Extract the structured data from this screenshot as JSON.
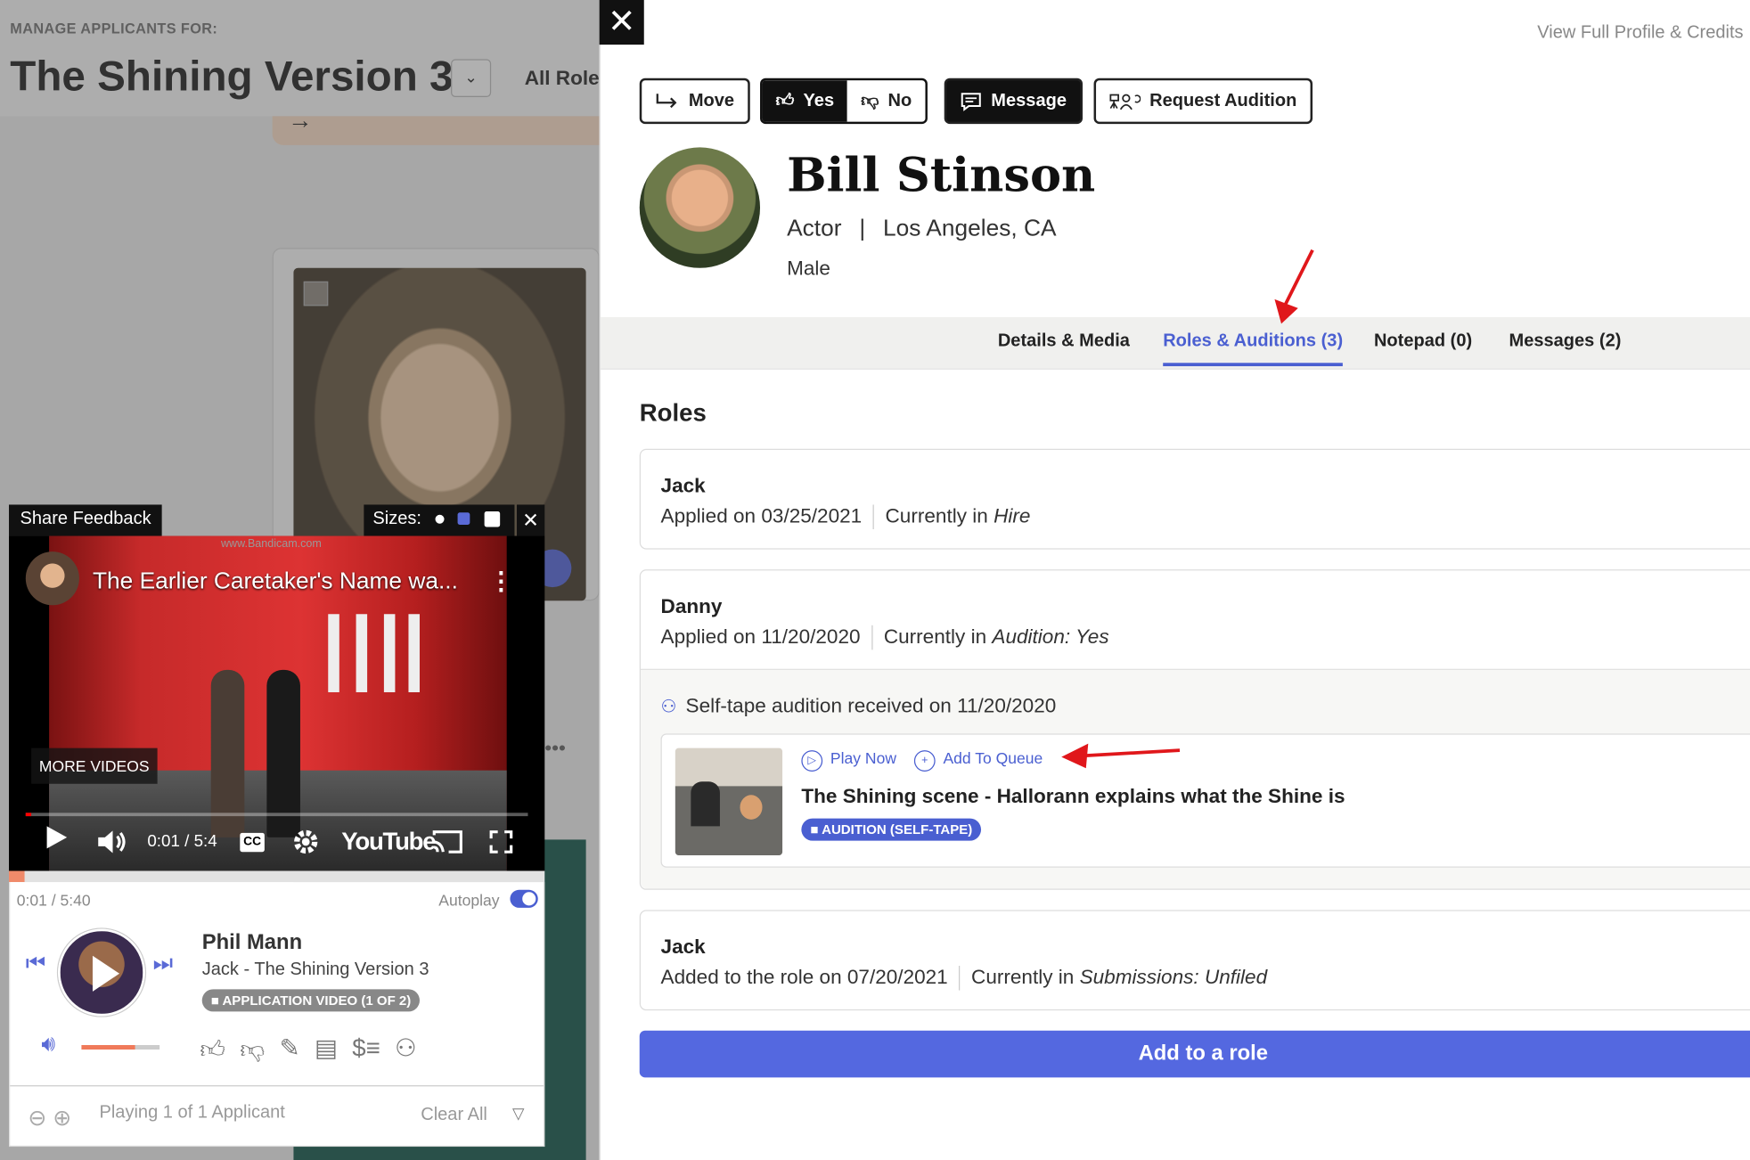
{
  "background": {
    "kicker": "MANAGE APPLICANTS FOR:",
    "project_title": "The Shining Version 3",
    "roles_filter": "All Role"
  },
  "player": {
    "share_feedback": "Share Feedback",
    "sizes_label": "Sizes:",
    "video_title": "The Earlier Caretaker's Name wa...",
    "watermark": "www.Bandicam.com",
    "more_videos": "MORE VIDEOS",
    "video_time": "0:01 / 5:4",
    "youtube": "YouTube",
    "cc": "CC",
    "elapsed": "0:01 / 5:40",
    "autoplay": "Autoplay",
    "applicant_name": "Phil Mann",
    "applicant_role": "Jack - The Shining Version 3",
    "badge": "APPLICATION VIDEO (1 OF 2)",
    "playing": "Playing 1 of 1 Applicant",
    "clear_all": "Clear All",
    "volume_level": 0.68,
    "video_progress": 0.003,
    "accent": "#4a5fd1"
  },
  "drawer": {
    "full_profile": "View Full Profile & Credits",
    "toolbar": {
      "move": "Move",
      "yes": "Yes",
      "no": "No",
      "message": "Message",
      "request_audition": "Request Audition"
    },
    "profile": {
      "name": "Bill Stinson",
      "occupation": "Actor",
      "location": "Los Angeles, CA",
      "gender": "Male"
    },
    "tabs": [
      {
        "label": "Details & Media",
        "active": false
      },
      {
        "label": "Roles & Auditions (3)",
        "active": true
      },
      {
        "label": "Notepad (0)",
        "active": false
      },
      {
        "label": "Messages (2)",
        "active": false
      }
    ],
    "section_title": "Roles",
    "roles": [
      {
        "role": "Jack",
        "applied": "Applied on 03/25/2021",
        "currently_label": "Currently in",
        "status": "Hire"
      },
      {
        "role": "Danny",
        "applied": "Applied on 11/20/2020",
        "currently_label": "Currently in",
        "status": "Audition: Yes",
        "self_tape": "Self-tape audition received on 11/20/2020",
        "play_now": "Play Now",
        "add_to_queue": "Add To Queue",
        "video_title": "The Shining scene - Hallorann explains what the Shine is",
        "video_badge": "AUDITION (SELF-TAPE)"
      },
      {
        "role": "Jack",
        "applied": "Added to the role on 07/20/2021",
        "currently_label": "Currently in",
        "status": "Submissions: Unfiled"
      }
    ],
    "add_role": "Add to a role",
    "brand_color": "#5468e0",
    "annotation_color": "#e0171b"
  }
}
